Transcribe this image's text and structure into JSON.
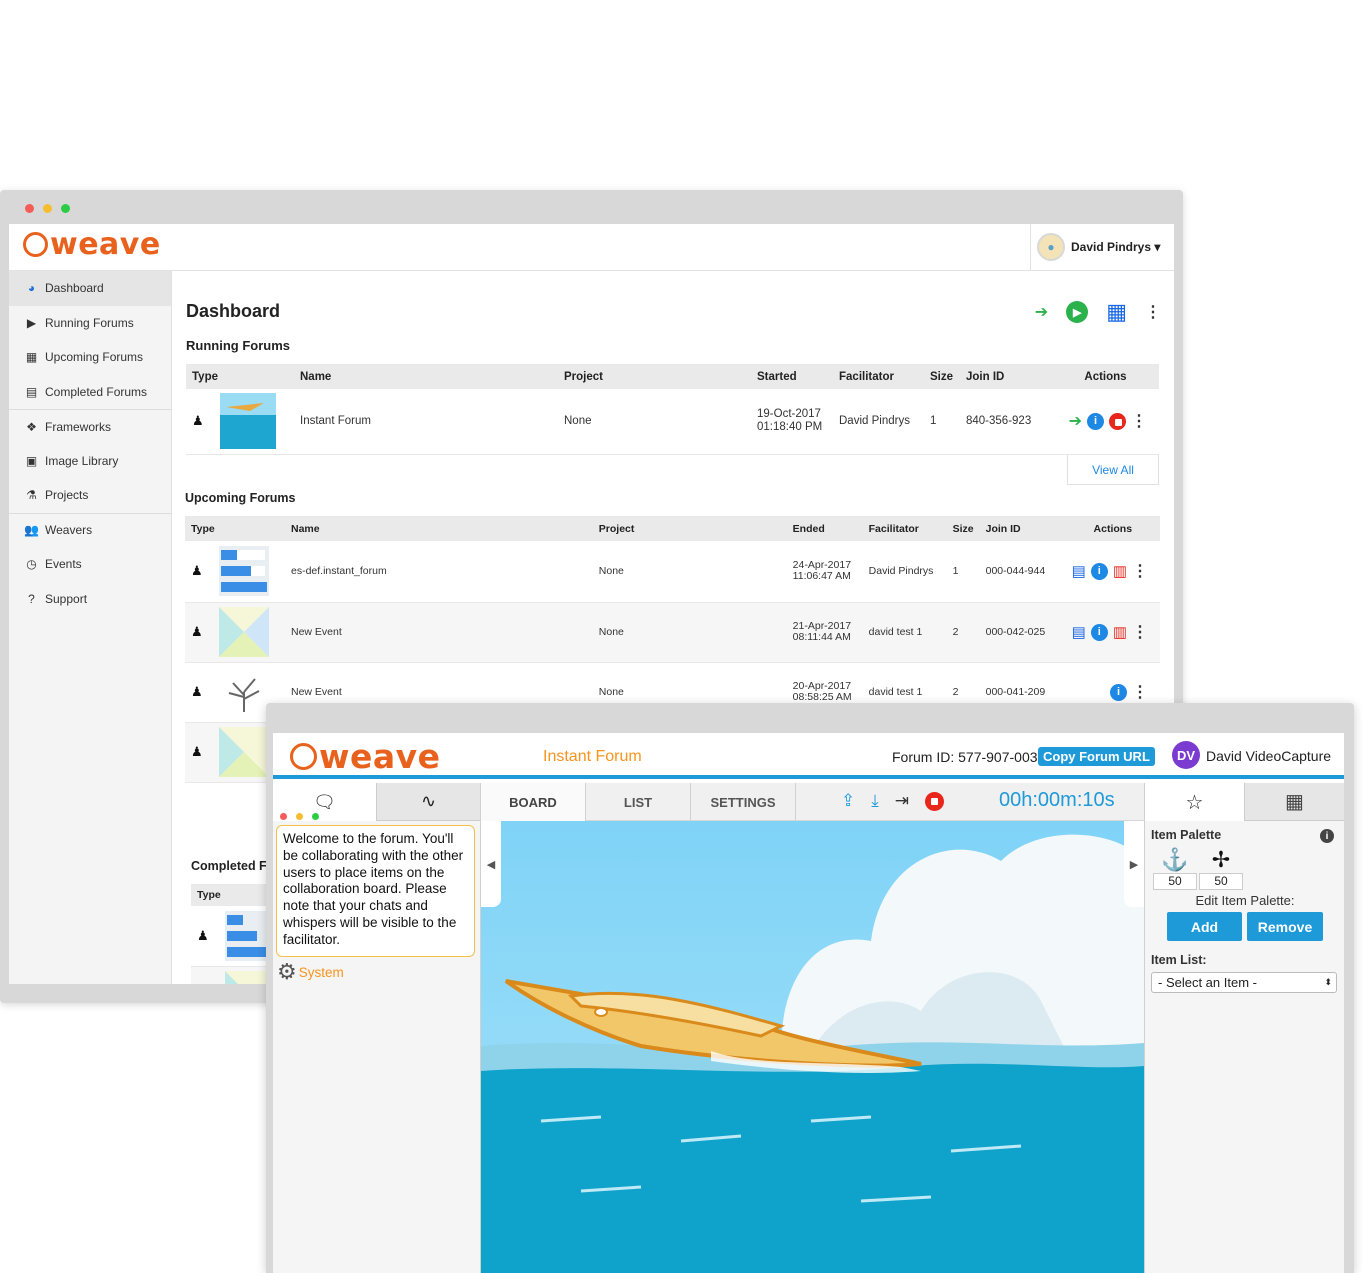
{
  "dashboard": {
    "logo": "weave",
    "user": "David Pindrys ▾",
    "sidebar": [
      {
        "label": "Dashboard",
        "icon": "dashboard-icon"
      },
      {
        "label": "Running Forums",
        "icon": "play-icon"
      },
      {
        "label": "Upcoming Forums",
        "icon": "calendar-icon"
      },
      {
        "label": "Completed Forums",
        "icon": "document-icon"
      },
      {
        "label": "Frameworks",
        "icon": "frameworks-icon"
      },
      {
        "label": "Image Library",
        "icon": "image-icon"
      },
      {
        "label": "Projects",
        "icon": "flask-icon"
      },
      {
        "label": "Weavers",
        "icon": "users-icon"
      },
      {
        "label": "Events",
        "icon": "clock-icon"
      },
      {
        "label": "Support",
        "icon": "question-icon"
      }
    ],
    "title": "Dashboard",
    "running": {
      "title": "Running Forums",
      "headers": [
        "Type",
        "Name",
        "Project",
        "Started",
        "Facilitator",
        "Size",
        "Join ID",
        "Actions"
      ],
      "rows": [
        {
          "name": "Instant Forum",
          "project": "None",
          "date": "19-Oct-2017",
          "time": "01:18:40 PM",
          "facilitator": "David Pindrys",
          "size": "1",
          "join_id": "840-356-923"
        }
      ],
      "view_all": "View All"
    },
    "upcoming": {
      "title": "Upcoming Forums",
      "headers": [
        "Type",
        "Name",
        "Project",
        "Ended",
        "Facilitator",
        "Size",
        "Join ID",
        "Actions"
      ],
      "rows": [
        {
          "name": "es-def.instant_forum",
          "project": "None",
          "date": "24-Apr-2017",
          "time": "11:06:47 AM",
          "facilitator": "David Pindrys",
          "size": "1",
          "join_id": "000-044-944"
        },
        {
          "name": "New Event",
          "project": "None",
          "date": "21-Apr-2017",
          "time": "08:11:44 AM",
          "facilitator": "david test 1",
          "size": "2",
          "join_id": "000-042-025"
        },
        {
          "name": "New Event",
          "project": "None",
          "date": "20-Apr-2017",
          "time": "08:58:25 AM",
          "facilitator": "david test 1",
          "size": "2",
          "join_id": "000-041-209"
        }
      ]
    },
    "completed": {
      "title": "Completed F",
      "headers": [
        "Type"
      ]
    }
  },
  "forum": {
    "logo": "weave",
    "name": "Instant Forum",
    "forum_id": "Forum ID: 577-907-003",
    "copy_url": "Copy Forum URL",
    "user_initials": "DV",
    "user_name": "David VideoCapture",
    "tabs": [
      "BOARD",
      "LIST",
      "SETTINGS"
    ],
    "timer": "00h:00m:10s",
    "chat_message": "Welcome to the forum. You'll be collaborating with the other users to place items on the collaboration board. Please note that your chats and whispers will be visible to the facilitator.",
    "chat_sender": "System",
    "palette": {
      "title": "Item Palette",
      "items": [
        {
          "icon": "anchor-icon",
          "count": "50"
        },
        {
          "icon": "propeller-icon",
          "count": "50"
        }
      ],
      "edit_label": "Edit Item Palette:",
      "add": "Add",
      "remove": "Remove",
      "list_label": "Item List:",
      "select_value": "- Select an Item -"
    }
  }
}
